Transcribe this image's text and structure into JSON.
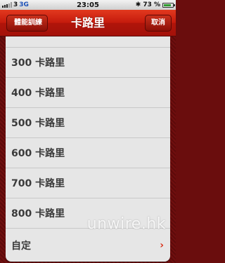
{
  "status_bar": {
    "carrier": "3",
    "network": "3G",
    "time": "23:05",
    "battery_percent": "73 %",
    "battery_level": 0.73
  },
  "nav": {
    "back_label": "體能訓練",
    "title": "卡路里",
    "cancel_label": "取消"
  },
  "list": {
    "items": [
      {
        "label": "300 卡路里"
      },
      {
        "label": "400 卡路里"
      },
      {
        "label": "500 卡路里"
      },
      {
        "label": "600 卡路里"
      },
      {
        "label": "700 卡路里"
      },
      {
        "label": "800 卡路里"
      },
      {
        "label": "自定",
        "chevron": "›"
      }
    ]
  },
  "watermark": "unwire.hk",
  "colors": {
    "accent": "#c51a0c",
    "chevron": "#d8321a",
    "list_bg": "#e6e6e6"
  }
}
